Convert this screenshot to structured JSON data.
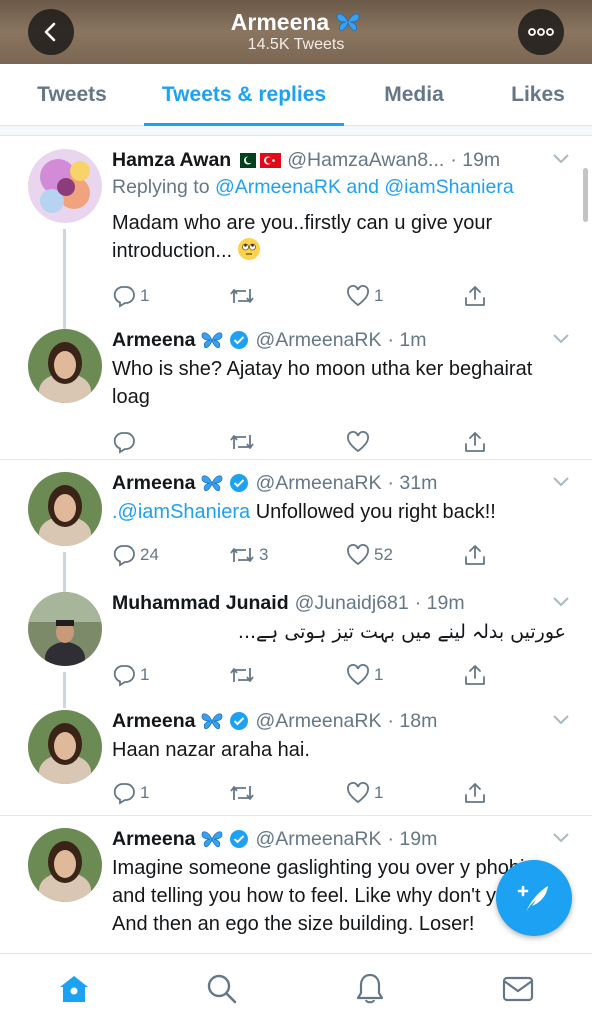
{
  "header": {
    "name": "Armeena",
    "subtitle": "14.5K Tweets"
  },
  "tabs": [
    {
      "label": "Tweets",
      "active": false
    },
    {
      "label": "Tweets & replies",
      "active": true
    },
    {
      "label": "Media",
      "active": false
    },
    {
      "label": "Likes",
      "active": false
    }
  ],
  "tweets": [
    {
      "name": "Hamza Awan",
      "handle": "@HamzaAwan8...",
      "time": "· 19m",
      "reply_prefix": "Replying to",
      "reply_user1": "@ArmeenaRK",
      "reply_and": "and",
      "reply_user2": "@iamShaniera",
      "text": "Madam who are you..firstly can u give your introduction...",
      "replies": "1",
      "retweets": "",
      "likes": "1"
    },
    {
      "name": "Armeena",
      "handle": "@ArmeenaRK",
      "time": "· 1m",
      "text": "Who is she? Ajatay ho moon utha ker beghairat loag",
      "replies": "",
      "retweets": "",
      "likes": ""
    },
    {
      "name": "Armeena",
      "handle": "@ArmeenaRK",
      "time": "· 31m",
      "mention": ".@iamShaniera",
      "text": " Unfollowed you right back!!",
      "replies": "24",
      "retweets": "3",
      "likes": "52"
    },
    {
      "name": "Muhammad Junaid",
      "handle": "@Junaidj681",
      "time": "· 19m",
      "text": "عورتیں بدلہ لینے میں بہت تیز ہوتی ہے...",
      "replies": "1",
      "retweets": "",
      "likes": "1"
    },
    {
      "name": "Armeena",
      "handle": "@ArmeenaRK",
      "time": "· 18m",
      "text": "Haan nazar araha hai.",
      "replies": "1",
      "retweets": "",
      "likes": "1"
    },
    {
      "name": "Armeena",
      "handle": "@ArmeenaRK",
      "time": "· 19m",
      "text": "Imagine someone gaslighting you over y phobias and telling you how to feel. Like why don't you? And then an ego the size building. Loser!",
      "replies": "",
      "retweets": "",
      "likes": ""
    }
  ],
  "colors": {
    "accent": "#1da1f2",
    "secondary_text": "#657786",
    "verified": "#1da1f2",
    "butterfly": "#1da1f2"
  },
  "icons": [
    "back-arrow-icon",
    "more-icon",
    "reply-icon",
    "retweet-icon",
    "like-icon",
    "share-icon",
    "compose-icon",
    "home-icon",
    "search-icon",
    "notifications-icon",
    "messages-icon",
    "verified-badge-icon",
    "butterfly-emoji-icon",
    "caret-down-icon"
  ]
}
